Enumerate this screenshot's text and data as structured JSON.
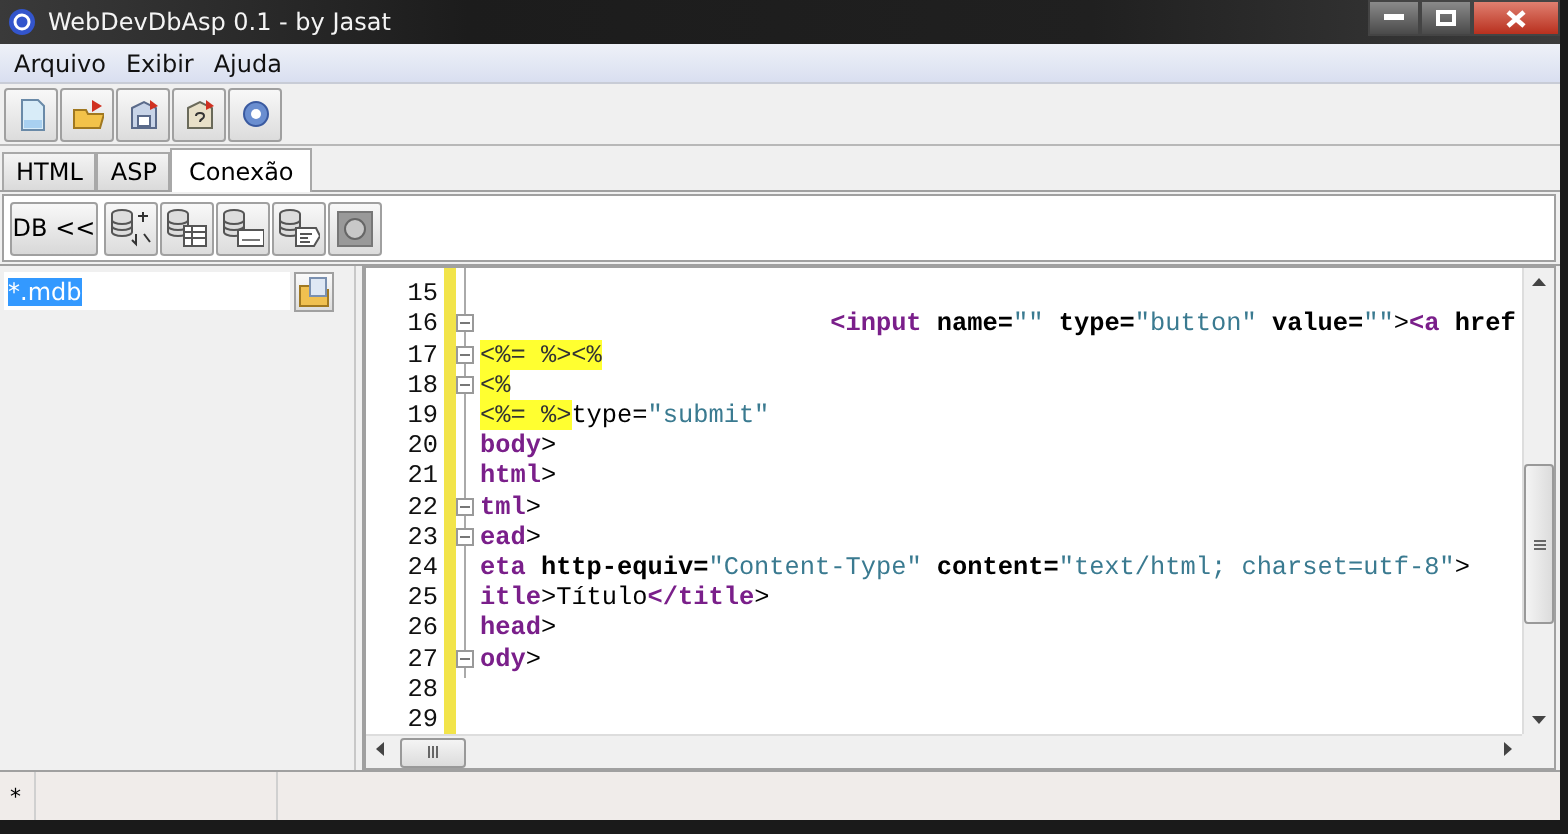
{
  "window": {
    "title": "WebDevDbAsp 0.1 - by Jasat"
  },
  "menu": [
    "Arquivo",
    "Exibir",
    "Ajuda"
  ],
  "tabs": [
    {
      "label": "HTML",
      "selected": false
    },
    {
      "label": "ASP",
      "selected": false
    },
    {
      "label": "Conexão",
      "selected": true
    }
  ],
  "db_toolbar": {
    "button": "DB <<"
  },
  "file_filter": {
    "value": "*.mdb",
    "selected": true
  },
  "editor": {
    "lines": [
      {
        "number": "15",
        "fold_start": false
      },
      {
        "number": "16",
        "fold_start": true,
        "segments": [
          {
            "kind": "tag",
            "text": "                       <input"
          },
          {
            "kind": "attr",
            "text": " name="
          },
          {
            "kind": "str",
            "text": "\"\""
          },
          {
            "kind": "attr",
            "text": " type="
          },
          {
            "kind": "str",
            "text": "\"button\""
          },
          {
            "kind": "attr",
            "text": " value="
          },
          {
            "kind": "str",
            "text": "\"\""
          },
          {
            "kind": "text",
            "text": ">"
          },
          {
            "kind": "tag",
            "text": "<a"
          },
          {
            "kind": "attr",
            "text": " href"
          }
        ]
      },
      {
        "number": "17",
        "fold_start": true,
        "segments": [
          {
            "kind": "asp",
            "text": "<%= %><%"
          }
        ]
      },
      {
        "number": "18",
        "fold_start": true,
        "segments": [
          {
            "kind": "asp",
            "text": "<%"
          }
        ]
      },
      {
        "number": "19",
        "fold_start": false,
        "segments": [
          {
            "kind": "asp",
            "text": "<%= %>"
          },
          {
            "kind": "text",
            "text": "type="
          },
          {
            "kind": "str",
            "text": "\"submit\""
          }
        ]
      },
      {
        "number": "20",
        "fold_start": false,
        "segments": [
          {
            "kind": "tag",
            "text": "body"
          },
          {
            "kind": "text",
            "text": ">"
          }
        ]
      },
      {
        "number": "21",
        "fold_start": false,
        "segments": [
          {
            "kind": "tag",
            "text": "html"
          },
          {
            "kind": "text",
            "text": ">"
          }
        ]
      },
      {
        "number": "22",
        "fold_start": true,
        "segments": [
          {
            "kind": "tag",
            "text": "tml"
          },
          {
            "kind": "text",
            "text": ">"
          }
        ]
      },
      {
        "number": "23",
        "fold_start": true,
        "segments": [
          {
            "kind": "tag",
            "text": "ead"
          },
          {
            "kind": "text",
            "text": ">"
          }
        ]
      },
      {
        "number": "24",
        "fold_start": false,
        "segments": [
          {
            "kind": "tag",
            "text": "eta"
          },
          {
            "kind": "attr",
            "text": " http-equiv="
          },
          {
            "kind": "str",
            "text": "\"Content-Type\""
          },
          {
            "kind": "attr",
            "text": " content="
          },
          {
            "kind": "str",
            "text": "\"text/html; charset=utf-8\""
          },
          {
            "kind": "text",
            "text": ">"
          }
        ]
      },
      {
        "number": "25",
        "fold_start": false,
        "segments": [
          {
            "kind": "tag",
            "text": "itle"
          },
          {
            "kind": "text",
            "text": ">Título"
          },
          {
            "kind": "tag",
            "text": "</title"
          },
          {
            "kind": "text",
            "text": ">"
          }
        ]
      },
      {
        "number": "26",
        "fold_start": false,
        "segments": [
          {
            "kind": "tag",
            "text": "head"
          },
          {
            "kind": "text",
            "text": ">"
          }
        ]
      },
      {
        "number": "27",
        "fold_start": true,
        "segments": [
          {
            "kind": "tag",
            "text": "ody"
          },
          {
            "kind": "text",
            "text": ">"
          }
        ]
      },
      {
        "number": "28",
        "fold_start": false
      },
      {
        "number": "29",
        "fold_start": false
      }
    ]
  },
  "status_bar": {
    "text": "*"
  }
}
